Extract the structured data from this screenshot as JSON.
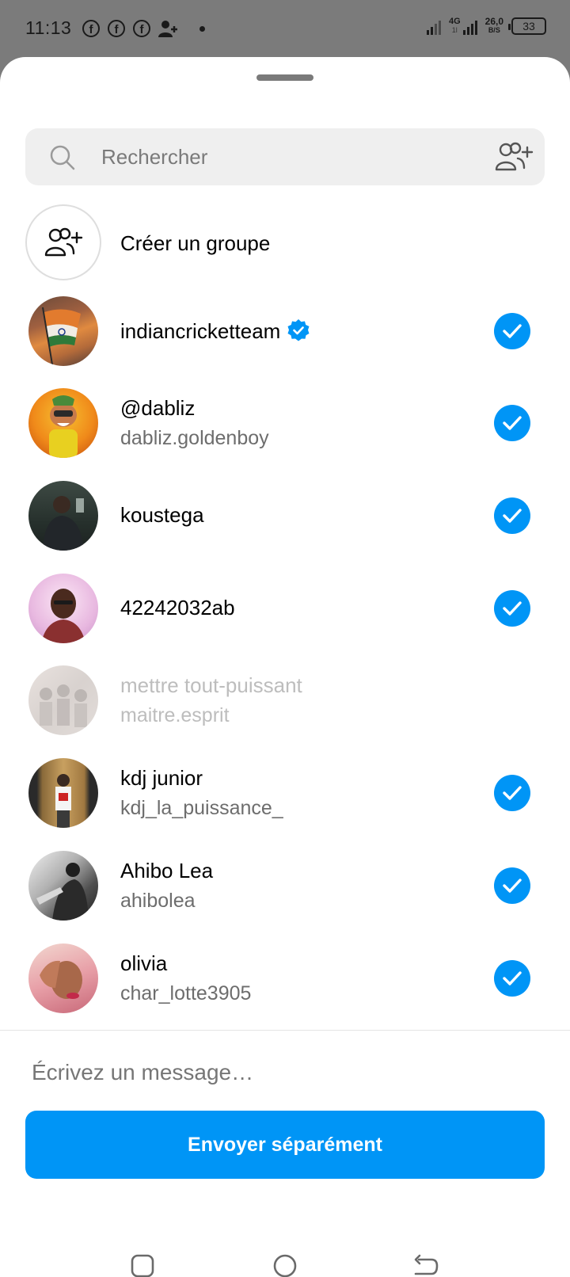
{
  "status_bar": {
    "time": "11:13",
    "network_type": "4G",
    "network_sub": "1l",
    "speed_value": "26,0",
    "speed_unit": "B/S",
    "battery": "33",
    "notification_icons": [
      "facebook-icon",
      "facebook-icon",
      "facebook-icon",
      "add-contact-icon",
      "dot-icon"
    ]
  },
  "search": {
    "placeholder": "Rechercher",
    "value": ""
  },
  "create_group": {
    "label": "Créer un groupe"
  },
  "contacts": [
    {
      "name": "indiancricketteam",
      "username": "",
      "verified": true,
      "selected": true,
      "disabled": false
    },
    {
      "name": "@dabliz",
      "username": "dabliz.goldenboy",
      "verified": false,
      "selected": true,
      "disabled": false
    },
    {
      "name": "koustega",
      "username": "",
      "verified": false,
      "selected": true,
      "disabled": false
    },
    {
      "name": "42242032ab",
      "username": "",
      "verified": false,
      "selected": true,
      "disabled": false
    },
    {
      "name": "mettre tout-puissant",
      "username": "maitre.esprit",
      "verified": false,
      "selected": false,
      "disabled": true
    },
    {
      "name": "kdj junior",
      "username": "kdj_la_puissance_",
      "verified": false,
      "selected": true,
      "disabled": false
    },
    {
      "name": "Ahibo Lea",
      "username": "ahibolea",
      "verified": false,
      "selected": true,
      "disabled": false
    },
    {
      "name": "olivia",
      "username": "char_lotte3905",
      "verified": false,
      "selected": true,
      "disabled": false
    }
  ],
  "message": {
    "placeholder": "Écrivez un message…",
    "value": ""
  },
  "send_button": {
    "label": "Envoyer séparément"
  },
  "colors": {
    "accent": "#0095f6",
    "sheet_background": "#ffffff",
    "scrim": "#7b7b7b"
  }
}
